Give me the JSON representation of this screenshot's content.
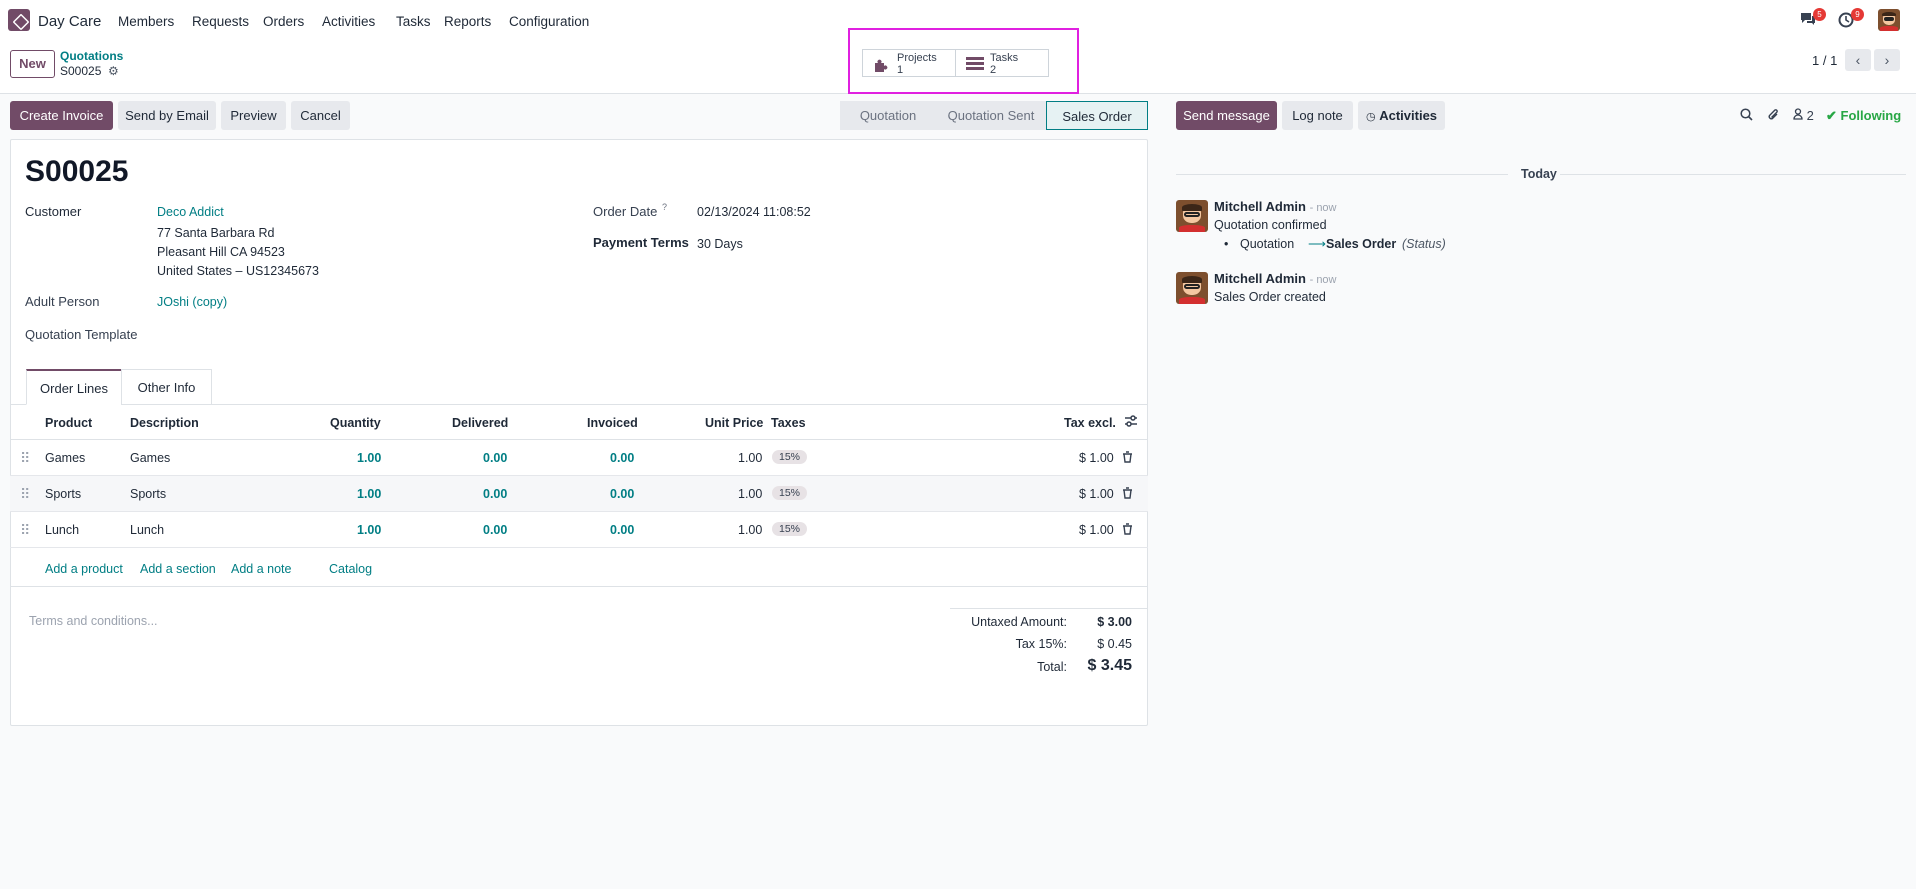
{
  "topnav": {
    "app_name": "Day Care",
    "menus": [
      "Members",
      "Requests",
      "Orders",
      "Activities",
      "Tasks",
      "Reports",
      "Configuration"
    ],
    "messages_badge": "5",
    "activities_badge": "9"
  },
  "control": {
    "new_label": "New",
    "breadcrumb_parent": "Quotations",
    "breadcrumb_current": "S00025",
    "smart_buttons": [
      {
        "label": "Projects",
        "value": "1",
        "icon": "puzzle-icon"
      },
      {
        "label": "Tasks",
        "value": "2",
        "icon": "tasks-icon"
      }
    ],
    "pager": "1 / 1"
  },
  "actions": {
    "create_invoice": "Create Invoice",
    "send_email": "Send by Email",
    "preview": "Preview",
    "cancel": "Cancel"
  },
  "statusbar": [
    "Quotation",
    "Quotation Sent",
    "Sales Order"
  ],
  "form": {
    "title": "S00025",
    "customer_label": "Customer",
    "customer_name": "Deco Addict",
    "address_1": "77 Santa Barbara Rd",
    "address_2": "Pleasant Hill CA 94523",
    "address_3": "United States – US12345673",
    "adult_label": "Adult Person",
    "adult_value": "JOshi (copy)",
    "template_label": "Quotation Template",
    "order_date_label": "Order Date",
    "order_date_help": "?",
    "order_date": "02/13/2024 11:08:52",
    "payment_terms_label": "Payment Terms",
    "payment_terms": "30 Days"
  },
  "tabs": [
    "Order Lines",
    "Other Info"
  ],
  "table": {
    "headers": {
      "product": "Product",
      "description": "Description",
      "quantity": "Quantity",
      "delivered": "Delivered",
      "invoiced": "Invoiced",
      "unit_price": "Unit Price",
      "taxes": "Taxes",
      "tax_excl": "Tax excl."
    },
    "rows": [
      {
        "product": "Games",
        "description": "Games",
        "quantity": "1.00",
        "delivered": "0.00",
        "invoiced": "0.00",
        "unit_price": "1.00",
        "tax": "15%",
        "subtotal": "$ 1.00"
      },
      {
        "product": "Sports",
        "description": "Sports",
        "quantity": "1.00",
        "delivered": "0.00",
        "invoiced": "0.00",
        "unit_price": "1.00",
        "tax": "15%",
        "subtotal": "$ 1.00"
      },
      {
        "product": "Lunch",
        "description": "Lunch",
        "quantity": "1.00",
        "delivered": "0.00",
        "invoiced": "0.00",
        "unit_price": "1.00",
        "tax": "15%",
        "subtotal": "$ 1.00"
      }
    ],
    "add_product": "Add a product",
    "add_section": "Add a section",
    "add_note": "Add a note",
    "catalog": "Catalog"
  },
  "terms_placeholder": "Terms and conditions...",
  "totals": {
    "untaxed_label": "Untaxed Amount:",
    "untaxed": "$ 3.00",
    "tax_label": "Tax 15%:",
    "tax": "$ 0.45",
    "total_label": "Total:",
    "total": "$ 3.45"
  },
  "chatter": {
    "send_message": "Send message",
    "log_note": "Log note",
    "activities": "Activities",
    "followers_count": "2",
    "following": "Following",
    "today": "Today",
    "messages": [
      {
        "author": "Mitchell Admin",
        "time": "- now",
        "body": "Quotation confirmed",
        "change_from": "Quotation",
        "change_to": "Sales Order",
        "change_field": "(Status)"
      },
      {
        "author": "Mitchell Admin",
        "time": "- now",
        "body": "Sales Order created"
      }
    ]
  },
  "colors": {
    "brand": "#714b67",
    "accent": "#017e84",
    "following": "#28a745",
    "highlight": "#e020e0"
  }
}
